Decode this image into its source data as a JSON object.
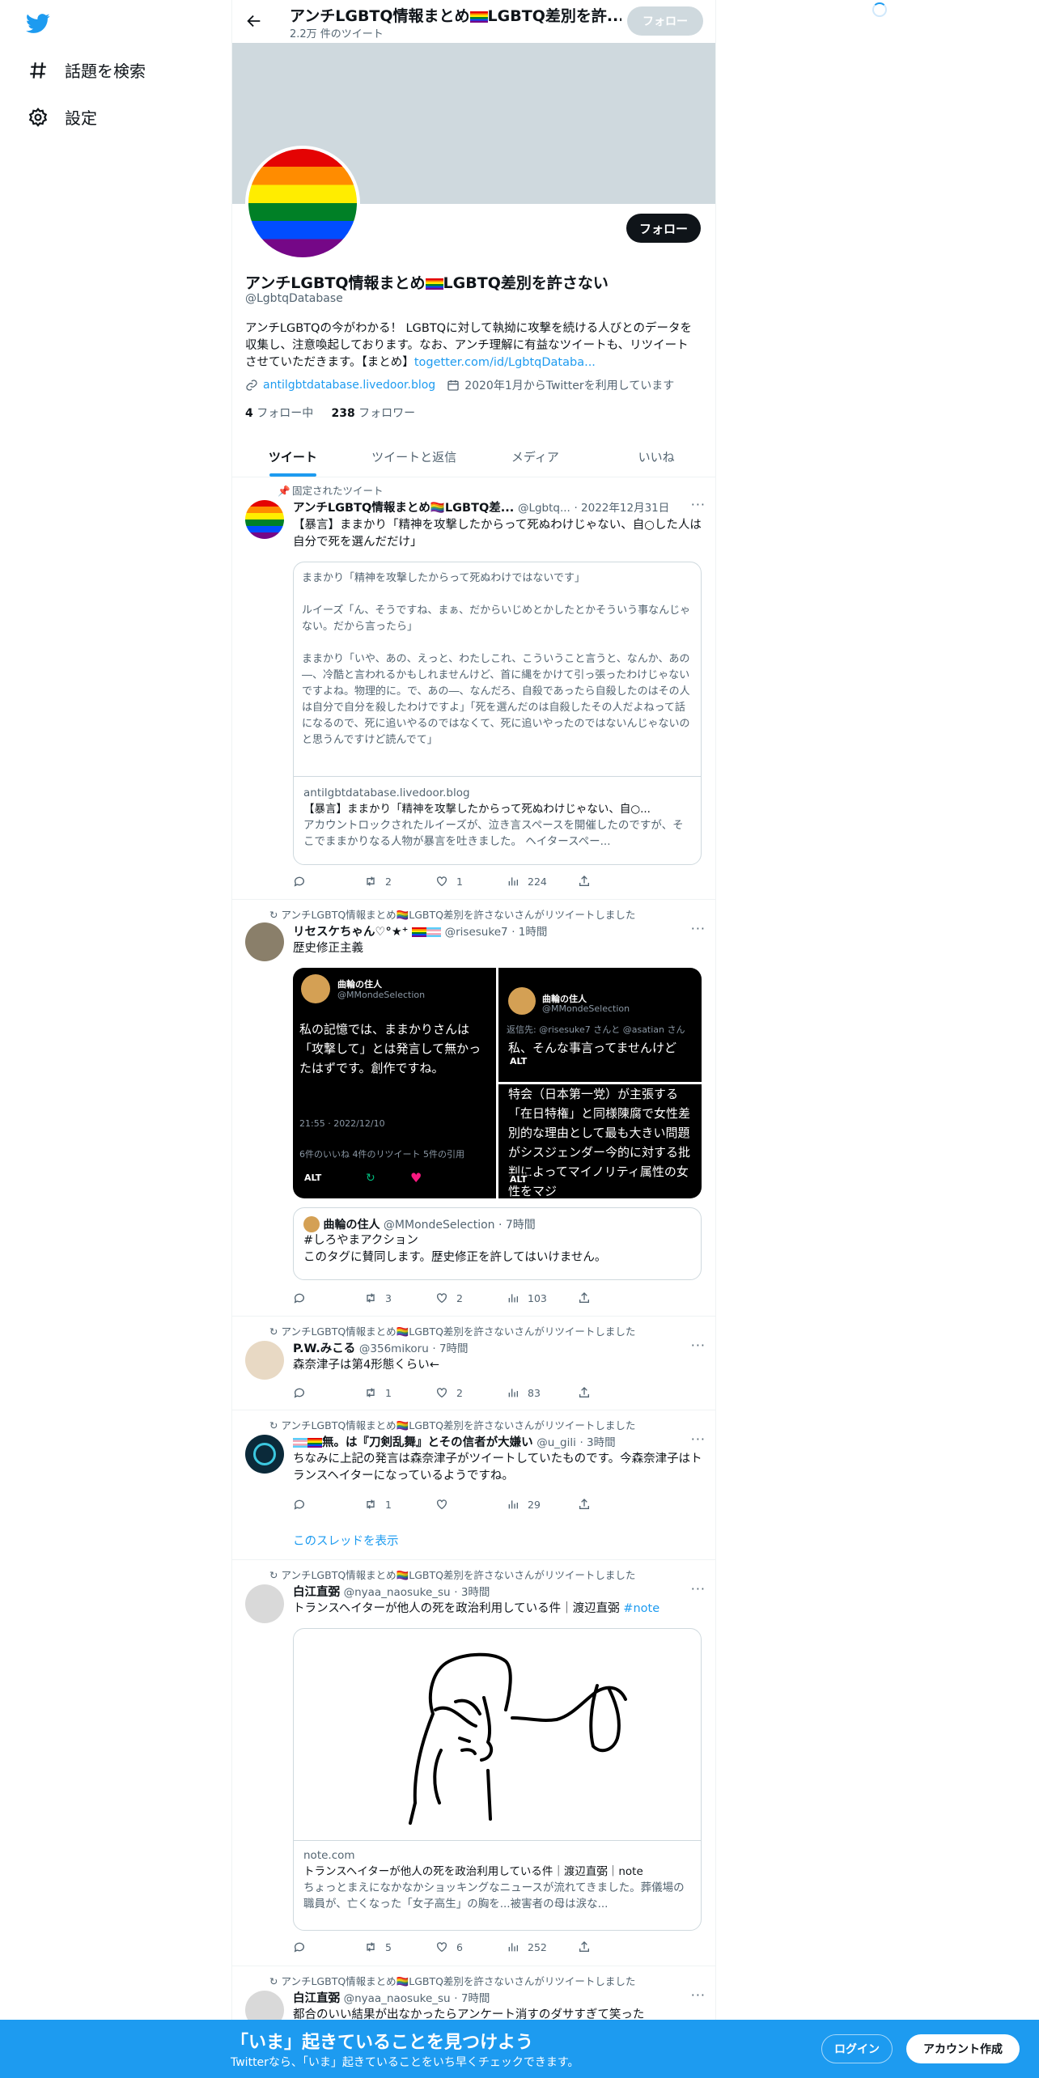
{
  "sidebar": {
    "items": [
      {
        "label": "話題を検索",
        "icon": "hashtag-icon"
      },
      {
        "label": "設定",
        "icon": "gear-icon"
      }
    ]
  },
  "header": {
    "name": "アンチLGBTQ情報まとめ🏳️‍🌈LGBTQ差別を許...",
    "tweet_count": "2.2万 件のツイート",
    "follow": "フォロー"
  },
  "profile": {
    "name_a": "アンチLGBTQ情報まとめ",
    "name_b": "LGBTQ差別を許さない",
    "handle": "@LgbtqDatabase",
    "follow": "フォロー",
    "bio": "アンチLGBTQの今がわかる！ LGBTQに対して執拗に攻撃を続ける人びとのデータを収集し、注意喚起しております。なお、アンチ理解に有益なツイートも、リツイートさせていただきます。【まとめ】",
    "bio_link": "togetter.com/id/LgbtqDataba...",
    "website": "antilgbtdatabase.livedoor.blog",
    "joined": "2020年1月からTwitterを利用しています",
    "following_count": "4",
    "following_label": "フォロー中",
    "followers_count": "238",
    "followers_label": "フォロワー"
  },
  "tabs": [
    "ツイート",
    "ツイートと返信",
    "メディア",
    "いいね"
  ],
  "tweets": [
    {
      "context": "固定されたツイート",
      "name": "アンチLGBTQ情報まとめ🏳️‍🌈LGBTQ差...",
      "handle": "@Lgbtq...",
      "time": "· 2022年12月31日",
      "text": "【暴言】ままかり「精神を攻撃したからって死ぬわけじゃない、自○した人は自分で死を選んだだけ」",
      "card_quote": [
        "ままかり「精神を攻撃したからって死ぬわけではないです」",
        "ルイーズ「ん、そうですね、まぁ、だからいじめとかしたとかそういう事なんじゃない。だから言ったら」",
        "ままかり「いや、あの、えっと、わたしこれ、こういうこと言うと、なんか、あの―、冷酷と言われるかもしれませんけど、首に縄をかけて引っ張ったわけじゃないですよね。物理的に。で、あの―、なんだろ、自殺であったら自殺したのはその人は自分で自分を殺したわけですよ」「死を選んだのは自殺したその人だよねって話になるので、死に追いやるのではなくて、死に追いやったのではないんじゃないのと思うんですけど読んでて」"
      ],
      "card_domain": "antilgbtdatabase.livedoor.blog",
      "card_title": "【暴言】ままかり「精神を攻撃したからって死ぬわけじゃない、自○...",
      "card_desc": "アカウントロックされたルイーズが、泣き言スペースを開催したのですが、そこでままかりなる人物が暴言を吐きました。 ヘイタースペー...",
      "replies": "",
      "retweets": "2",
      "likes": "1",
      "views": "224"
    },
    {
      "context": "アンチLGBTQ情報まとめ🏳️‍🌈LGBTQ差別を許さないさんがリツイートしました",
      "name": "リセスケちゃん♡°★⁺",
      "handle": "@risesuke7",
      "time": "· 1時間",
      "text": "歴史修正主義",
      "img1_name": "曲輪の住人",
      "img1_handle": "@MMondeSelection",
      "img1_text": "私の記憶では、ままかりさんは「攻撃して」とは発言して無かったはずです。創作ですね。",
      "img1_date": "21:55 · 2022/12/10",
      "img1_stats": "6件のいいね  4件のリツイート  5件の引用",
      "img2_name": "曲輪の住人",
      "img2_handle": "@MMondeSelection",
      "img2_reply": "返信先: @risesuke7 さんと @asatian さん",
      "img2_text": "私、そんな事言ってませんけど",
      "img3_text": "特会（日本第一党）が主張する「在日特権」と同様陳腐で女性差別的な理由として最も大きい問題がシスジェンダー今的に対する批判によってマイノリティ属性の女性をマジ",
      "alt": "ALT",
      "quote_name": "曲輪の住人",
      "quote_handle": "@MMondeSelection",
      "quote_time": "· 7時間",
      "quote_text": "#しろやまアクション\nこのタグに賛同します。歴史修正を許してはいけません。",
      "replies": "",
      "retweets": "3",
      "likes": "2",
      "views": "103"
    },
    {
      "context": "アンチLGBTQ情報まとめ🏳️‍🌈LGBTQ差別を許さないさんがリツイートしました",
      "name": "P.W.みこる",
      "handle": "@356mikoru",
      "time": "· 7時間",
      "text": "森奈津子は第4形態くらい←",
      "replies": "",
      "retweets": "1",
      "likes": "2",
      "views": "83"
    },
    {
      "context": "アンチLGBTQ情報まとめ🏳️‍🌈LGBTQ差別を許さないさんがリツイートしました",
      "name": "無。は『刀剣乱舞』とその信者が大嫌い",
      "handle": "@u_gili",
      "time": "· 3時間",
      "text": "ちなみに上記の発言は森奈津子がツイートしていたものです。今森奈津子はトランスヘイターになっているようですね。",
      "replies": "",
      "retweets": "1",
      "likes": "",
      "views": "29",
      "thread": "このスレッドを表示"
    },
    {
      "context": "アンチLGBTQ情報まとめ🏳️‍🌈LGBTQ差別を許さないさんがリツイートしました",
      "name": "白江直弼",
      "handle": "@nyaa_naosuke_su",
      "time": "· 3時間",
      "text": "トランスヘイターが他人の死を政治利用している件｜渡辺直弼 ",
      "hashtag": "#note",
      "card_domain": "note.com",
      "card_title": "トランスヘイターが他人の死を政治利用している件｜渡辺直弼｜note",
      "card_desc": "ちょっとまえになかなかショッキングなニュースが流れてきました。葬儀場の職員が、亡くなった「女子高生」の胸を...被害者の母は涙な...",
      "replies": "",
      "retweets": "5",
      "likes": "6",
      "views": "252"
    },
    {
      "context": "アンチLGBTQ情報まとめ🏳️‍🌈LGBTQ差別を許さないさんがリツイートしました",
      "name": "白江直弼",
      "handle": "@nyaa_naosuke_su",
      "time": "· 7時間",
      "text": "都合のいい結果が出なかったらアンケート消すのダサすぎて笑った"
    }
  ],
  "banner": {
    "title": "「いま」起きていることを見つけよう",
    "subtitle": "Twitterなら、「いま」起きていることをいち早くチェックできます。",
    "login": "ログイン",
    "signup": "アカウント作成"
  },
  "colors": {
    "accent": "#1d9bf0",
    "text": "#0f1419",
    "muted": "#536471"
  }
}
